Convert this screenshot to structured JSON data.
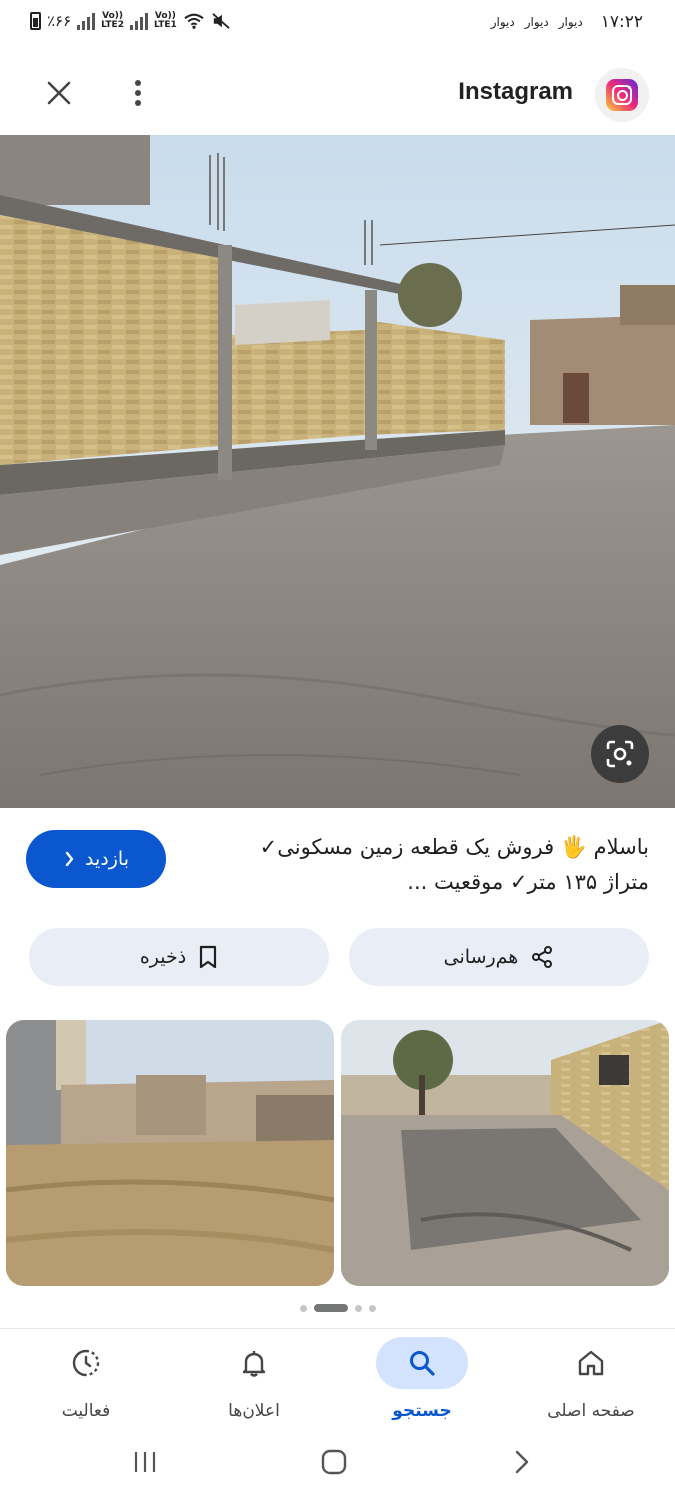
{
  "status_bar": {
    "battery": "٪۶۶",
    "sim2": "LTE2",
    "sim1": "LTE1",
    "volte": "Vo))",
    "notifications": [
      "دیوار",
      "دیوار",
      "دیوار"
    ],
    "time": "۱۷:۲۲"
  },
  "header": {
    "title": "Instagram"
  },
  "result": {
    "caption_line1": "باسلام 🖐 فروش یک قطعه زمین مسکونی✓",
    "caption_line2": "متراژ ۱۳۵ متر✓ موقعیت ...",
    "visit_label": "بازدید"
  },
  "actions": {
    "share_label": "هم‌رسانی",
    "save_label": "ذخیره"
  },
  "pager": {
    "count": 5,
    "active_index": 1
  },
  "bottom_nav": {
    "home": "صفحه اصلی",
    "search": "جستجو",
    "notifications": "اعلان‌ها",
    "activity": "فعالیت"
  },
  "colors": {
    "accent": "#0b57d0",
    "action_bg": "#e9eef6",
    "active_nav_bg": "#d3e3fd"
  }
}
